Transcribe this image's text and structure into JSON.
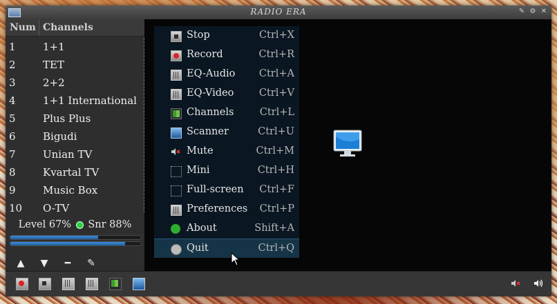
{
  "window": {
    "title": "RADIO ERA"
  },
  "channel_list": {
    "headers": {
      "num": "Num",
      "channels": "Channels"
    },
    "rows": [
      {
        "num": "1",
        "name": "1+1"
      },
      {
        "num": "2",
        "name": "TET"
      },
      {
        "num": "3",
        "name": "2+2"
      },
      {
        "num": "4",
        "name": "1+1 International"
      },
      {
        "num": "5",
        "name": "Plus Plus"
      },
      {
        "num": "6",
        "name": "Bigudi"
      },
      {
        "num": "7",
        "name": "Unian TV"
      },
      {
        "num": "8",
        "name": "Kvartal TV"
      },
      {
        "num": "9",
        "name": "Music Box"
      },
      {
        "num": "10",
        "name": "O-TV"
      }
    ]
  },
  "signal": {
    "level_label": "Level 67%",
    "snr_label": "Snr 88%",
    "level_fraction": 0.67,
    "snr_fraction": 0.88,
    "bar_color": "#3d8fd8",
    "status_dot_color": "#2fd13a"
  },
  "context_menu": {
    "items": [
      {
        "label": "Stop",
        "shortcut": "Ctrl+X",
        "icon": "stop-icon"
      },
      {
        "label": "Record",
        "shortcut": "Ctrl+R",
        "icon": "record-icon"
      },
      {
        "label": "EQ-Audio",
        "shortcut": "Ctrl+A",
        "icon": "eq-audio-icon"
      },
      {
        "label": "EQ-Video",
        "shortcut": "Ctrl+V",
        "icon": "eq-video-icon"
      },
      {
        "label": "Channels",
        "shortcut": "Ctrl+L",
        "icon": "channels-icon"
      },
      {
        "label": "Scanner",
        "shortcut": "Ctrl+U",
        "icon": "scanner-icon"
      },
      {
        "label": "Mute",
        "shortcut": "Ctrl+M",
        "icon": "mute-icon"
      },
      {
        "label": "Mini",
        "shortcut": "Ctrl+H",
        "icon": "mini-icon"
      },
      {
        "label": "Full-screen",
        "shortcut": "Ctrl+F",
        "icon": "fullscreen-icon"
      },
      {
        "label": "Preferences",
        "shortcut": "Ctrl+P",
        "icon": "preferences-icon"
      },
      {
        "label": "About",
        "shortcut": "Shift+A",
        "icon": "about-icon"
      },
      {
        "label": "Quit",
        "shortcut": "Ctrl+Q",
        "icon": "quit-icon",
        "highlighted": true
      }
    ]
  },
  "colors": {
    "menu_bg": "#0a1722",
    "highlight": "#163447",
    "window_bg": "#2b2b2b"
  }
}
